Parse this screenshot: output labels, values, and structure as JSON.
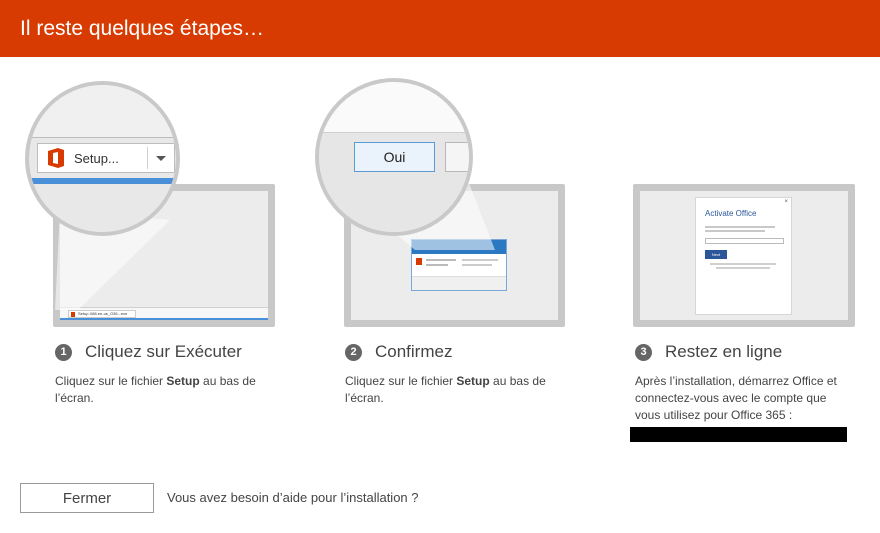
{
  "header": {
    "title": "Il reste quelques étapes…"
  },
  "steps": [
    {
      "number": "1",
      "title": "Cliquez sur Exécuter",
      "desc_pre": "Cliquez sur le fichier ",
      "desc_bold": "Setup",
      "desc_post": " au bas de l’écran.",
      "magnifier": {
        "button_label": "Setup..."
      },
      "screen": {
        "download_label": "Setup.X86.en-us_O36...exe"
      }
    },
    {
      "number": "2",
      "title": "Confirmez",
      "desc_pre": "Cliquez sur le fichier ",
      "desc_bold": "Setup",
      "desc_post": " au bas de l’écran.",
      "magnifier": {
        "button_label": "Oui"
      }
    },
    {
      "number": "3",
      "title": "Restez en ligne",
      "desc_line": "Après l’installation, démarrez Office et connectez-vous avec le compte que vous utilisez pour Office 365 :",
      "screen": {
        "dialog_title": "Activate Office",
        "next_label": "Next"
      }
    }
  ],
  "footer": {
    "close_label": "Fermer",
    "help_text": "Vous avez besoin d’aide pour l’installation ?"
  },
  "colors": {
    "header": "#d83b01",
    "office": "#d83b01",
    "dialog_blue": "#2b579a"
  }
}
